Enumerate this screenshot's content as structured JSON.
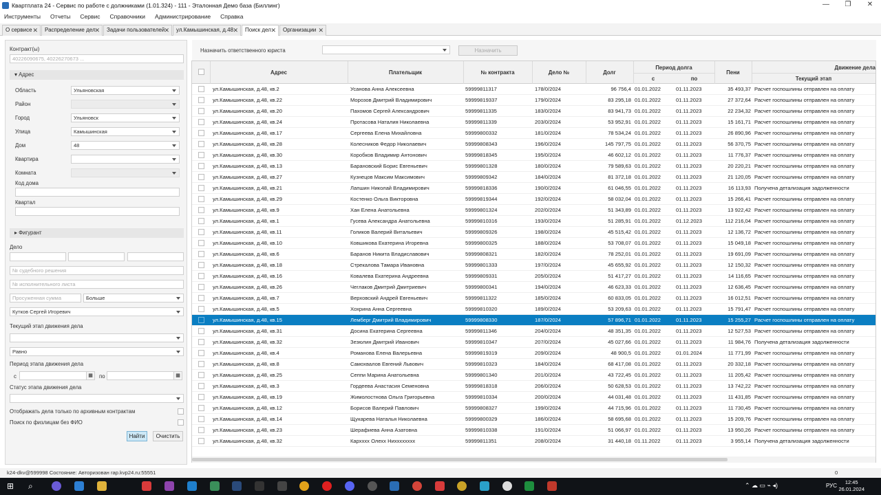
{
  "window": {
    "title": "Квартплата 24 - Сервис по работе с должниками (1.01.324) - 111 - Эталонная Демо база (Биллинг)"
  },
  "menu": [
    "Инструменты",
    "Отчеты",
    "Сервис",
    "Справочники",
    "Администрирование",
    "Справка"
  ],
  "tabs": [
    {
      "label": "О сервисе"
    },
    {
      "label": "Распределение дел"
    },
    {
      "label": "Задачи пользователей"
    },
    {
      "label": "ул.Камышинская, д.48"
    },
    {
      "label": "Поиск дел"
    },
    {
      "label": "Организации"
    }
  ],
  "filters": {
    "contracts_label": "Контракт(ы)",
    "contracts_placeholder": "40226090675, 40226270673 ...",
    "address_section": "Адрес",
    "region_label": "Область",
    "region_value": "Ульяновская",
    "district_label": "Район",
    "city_label": "Город",
    "city_value": "Ульяновск",
    "street_label": "Улица",
    "street_value": "Камышинская",
    "house_label": "Дом",
    "house_value": "48",
    "apartment_label": "Квартира",
    "room_label": "Комната",
    "house_code_label": "Код дома",
    "quarter_label": "Квартал",
    "defendant_section": "Фигурант",
    "case_label": "Дело",
    "court_decision_placeholder": "№ судебного решения",
    "exec_list_placeholder": "№ исполнительного листа",
    "amount_placeholder": "Просуженная сумма",
    "compare_value": "Больше",
    "lawyer_value": "Кутков Сергей Игоревич",
    "stage_label": "Текущий этап движения дела",
    "equal_value": "Равно",
    "period_label": "Период этапа движения дела",
    "from_label": "с",
    "to_label": "по",
    "status_label": "Статус этапа движения дела",
    "archive_label": "Отображать дела только по архивным контрактам",
    "physical_label": "Поиск по физлицам без ФИО",
    "find_button": "Найти",
    "clear_button": "Очистить"
  },
  "toolbar": {
    "assign_label": "Назначить ответственного юриста",
    "assign_button": "Назначить"
  },
  "columns": {
    "address": "Адрес",
    "payer": "Плательщик",
    "contract": "№ контракта",
    "case": "Дело №",
    "debt": "Долг",
    "period": "Период долга",
    "period_from": "с",
    "period_to": "по",
    "penalty": "Пени",
    "movement": "Движение дела",
    "stage": "Текущий этап"
  },
  "rows": [
    [
      "ул.Камышинская, д.48, кв.2",
      "Усанова Анна Алексеевна",
      "59999811317",
      "178/0/2024",
      "96 756,4",
      "01.01.2022",
      "01.11.2023",
      "35 493,37",
      "Расчет госпошлины отправлен на оплату"
    ],
    [
      "ул.Камышинская, д.48, кв.22",
      "Морозов Дмитрий Владимирович",
      "59999819337",
      "179/0/2024",
      "83 295,18",
      "01.01.2022",
      "01.11.2023",
      "27 372,64",
      "Расчет госпошлины отправлен на оплату"
    ],
    [
      "ул.Камышинская, д.48, кв.20",
      "Пахомов Сергей Александрович",
      "59999811335",
      "183/0/2024",
      "83 941,73",
      "01.01.2022",
      "01.11.2023",
      "22 234,32",
      "Расчет госпошлины отправлен на оплату"
    ],
    [
      "ул.Камышинская, д.48, кв.24",
      "Протасова Наталия Николаевна",
      "59999811339",
      "203/0/2024",
      "53 952,91",
      "01.01.2022",
      "01.11.2023",
      "15 161,71",
      "Расчет госпошлины отправлен на оплату"
    ],
    [
      "ул.Камышинская, д.48, кв.17",
      "Сергеева Елена Михайловна",
      "59999800332",
      "181/0/2024",
      "78 534,24",
      "01.01.2022",
      "01.11.2023",
      "26 890,96",
      "Расчет госпошлины отправлен на оплату"
    ],
    [
      "ул.Камышинская, д.48, кв.28",
      "Колесников Федор Николаевич",
      "59999808343",
      "196/0/2024",
      "145 797,75",
      "01.01.2022",
      "01.11.2023",
      "56 370,75",
      "Расчет госпошлины отправлен на оплату"
    ],
    [
      "ул.Камышинская, д.48, кв.30",
      "Коробков Владимир Антонович",
      "59999818345",
      "195/0/2024",
      "46 602,12",
      "01.01.2022",
      "01.11.2023",
      "11 776,37",
      "Расчет госпошлины отправлен на оплату"
    ],
    [
      "ул.Камышинская, д.48, кв.13",
      "Барановский Борис Евгеньевич",
      "59999801328",
      "180/0/2024",
      "79 589,63",
      "01.01.2022",
      "01.11.2023",
      "20 220,21",
      "Расчет госпошлины отправлен на оплату"
    ],
    [
      "ул.Камышинская, д.48, кв.27",
      "Кузнецов Максим Максимович",
      "59999809342",
      "184/0/2024",
      "81 372,18",
      "01.01.2022",
      "01.11.2023",
      "21 120,05",
      "Расчет госпошлины отправлен на оплату"
    ],
    [
      "ул.Камышинская, д.48, кв.21",
      "Лапшин Николай Владимирович",
      "59999818336",
      "190/0/2024",
      "61 046,55",
      "01.01.2022",
      "01.11.2023",
      "16 113,93",
      "Получена детализация задолженности"
    ],
    [
      "ул.Камышинская, д.48, кв.29",
      "Костенко Ольга Викторовна",
      "59999819344",
      "192/0/2024",
      "58 032,04",
      "01.01.2022",
      "01.11.2023",
      "15 266,41",
      "Расчет госпошлины отправлен на оплату"
    ],
    [
      "ул.Камышинская, д.48, кв.9",
      "Хан Елена Анатольевна",
      "59999801324",
      "202/0/2024",
      "51 343,89",
      "01.01.2022",
      "01.11.2023",
      "13 922,42",
      "Расчет госпошлины отправлен на оплату"
    ],
    [
      "ул.Камышинская, д.48, кв.1",
      "Гусева Александра Анатольевна",
      "59999810316",
      "193/0/2024",
      "51 285,91",
      "01.01.2022",
      "01.12.2023",
      "112 216,04",
      "Расчет госпошлины отправлен на оплату"
    ],
    [
      "ул.Камышинская, д.48, кв.11",
      "Голиков Валерий Витальевич",
      "59999809326",
      "198/0/2024",
      "45 515,42",
      "01.01.2022",
      "01.11.2023",
      "12 136,72",
      "Расчет госпошлины отправлен на оплату"
    ],
    [
      "ул.Камышинская, д.48, кв.10",
      "Ковшикова Екатерина Игоревна",
      "59999800325",
      "188/0/2024",
      "53 708,07",
      "01.01.2022",
      "01.11.2023",
      "15 049,18",
      "Расчет госпошлины отправлен на оплату"
    ],
    [
      "ул.Камышинская, д.48, кв.6",
      "Баранов Никита Владиславович",
      "59999808321",
      "182/0/2024",
      "78 252,01",
      "01.01.2022",
      "01.11.2023",
      "19 691,09",
      "Расчет госпошлины отправлен на оплату"
    ],
    [
      "ул.Камышинская, д.48, кв.18",
      "Стрекалова Тамара Ивановна",
      "59999801333",
      "197/0/2024",
      "45 655,92",
      "01.01.2022",
      "01.11.2023",
      "12 150,32",
      "Расчет госпошлины отправлен на оплату"
    ],
    [
      "ул.Камышинская, д.48, кв.16",
      "Ковалева Екатерина Андреевна",
      "59999809331",
      "205/0/2024",
      "51 417,27",
      "01.01.2022",
      "01.11.2023",
      "14 116,65",
      "Расчет госпошлины отправлен на оплату"
    ],
    [
      "ул.Камышинская, д.48, кв.26",
      "Чеглаков Дмитрий Дмитриевич",
      "59999800341",
      "194/0/2024",
      "46 623,33",
      "01.01.2022",
      "01.11.2023",
      "12 636,45",
      "Расчет госпошлины отправлен на оплату"
    ],
    [
      "ул.Камышинская, д.48, кв.7",
      "Верховский Андрей Евгеньевич",
      "59999811322",
      "185/0/2024",
      "60 833,05",
      "01.01.2022",
      "01.11.2023",
      "16 012,51",
      "Расчет госпошлины отправлен на оплату"
    ],
    [
      "ул.Камышинская, д.48, кв.5",
      "Хохрина Анна Сергеевна",
      "59999810320",
      "189/0/2024",
      "53 209,63",
      "01.01.2022",
      "01.11.2023",
      "15 791,47",
      "Расчет госпошлины отправлен на оплату"
    ],
    [
      "ул.Камышинская, д.48, кв.15",
      "Лемберг Дмитрий Владимирович",
      "59999808330",
      "187/0/2024",
      "57 896,71",
      "01.01.2022",
      "01.11.2023",
      "15 255,27",
      "Расчет госпошлины отправлен на оплату"
    ],
    [
      "ул.Камышинская, д.48, кв.31",
      "Досина Екатерина Сергеевна",
      "59999811346",
      "204/0/2024",
      "48 351,35",
      "01.01.2022",
      "01.11.2023",
      "12 527,53",
      "Расчет госпошлины отправлен на оплату"
    ],
    [
      "ул.Камышинская, д.48, кв.32",
      "Зезюлин Дмитрий Иванович",
      "59999810347",
      "207/0/2024",
      "45 027,66",
      "01.01.2022",
      "01.11.2023",
      "11 984,76",
      "Получена детализация задолженности"
    ],
    [
      "ул.Камышинская, д.48, кв.4",
      "Романова Елена Валерьевна",
      "59999819319",
      "209/0/2024",
      "48 900,5",
      "01.01.2022",
      "01.01.2024",
      "11 771,99",
      "Расчет госпошлины отправлен на оплату"
    ],
    [
      "ул.Камышинская, д.48, кв.8",
      "Самохвалов Евгений Львович",
      "59999810323",
      "184/0/2024",
      "68 417,08",
      "01.01.2022",
      "01.11.2023",
      "20 332,18",
      "Расчет госпошлины отправлен на оплату"
    ],
    [
      "ул.Камышинская, д.48, кв.25",
      "Сеппи Марина Анатольевна",
      "59999801340",
      "201/0/2024",
      "43 722,45",
      "01.01.2022",
      "01.11.2023",
      "11 205,42",
      "Расчет госпошлины отправлен на оплату"
    ],
    [
      "ул.Камышинская, д.48, кв.3",
      "Гордеева Анастасия Семеновна",
      "59999818318",
      "206/0/2024",
      "50 628,53",
      "01.01.2022",
      "01.11.2023",
      "13 742,22",
      "Расчет госпошлины отправлен на оплату"
    ],
    [
      "ул.Камышинская, д.48, кв.19",
      "Жимолостнова Ольга Григорьевна",
      "59999810334",
      "200/0/2024",
      "44 031,48",
      "01.01.2022",
      "01.11.2023",
      "11 431,85",
      "Расчет госпошлины отправлен на оплату"
    ],
    [
      "ул.Камышинская, д.48, кв.12",
      "Борисов Валерий Павлович",
      "59999808327",
      "199/0/2024",
      "44 715,96",
      "01.01.2022",
      "01.11.2023",
      "11 730,45",
      "Расчет госпошлины отправлен на оплату"
    ],
    [
      "ул.Камышинская, д.48, кв.14",
      "Щукарева Наталья Николаевна",
      "59999800329",
      "186/0/2024",
      "58 695,68",
      "01.01.2022",
      "01.11.2023",
      "15 209,76",
      "Расчет госпошлины отправлен на оплату"
    ],
    [
      "ул.Камышинская, д.48, кв.23",
      "Шерафиева Анна Азатовна",
      "59999810338",
      "191/0/2024",
      "51 066,97",
      "01.01.2022",
      "01.11.2023",
      "13 950,26",
      "Расчет госпошлины отправлен на оплату"
    ],
    [
      "ул.Камышинская, д.48, кв.32",
      "Кархххх Олехх Нихххххххх",
      "59999811351",
      "208/0/2024",
      "31 440,18",
      "01.11.2022",
      "01.11.2023",
      "3 955,14",
      "Получена детализация задолженности"
    ]
  ],
  "selected_row": 21,
  "status": {
    "text": "k24-dkv@599998 Состояние: Авторизован rap.kvp24.ru:55551",
    "counter": "0"
  },
  "taskbar": {
    "lang": "РУС",
    "time": "12:45",
    "date": "26.01.2024"
  },
  "colors": {
    "selection": "#0a7ec2",
    "taskbar": "#101317"
  }
}
